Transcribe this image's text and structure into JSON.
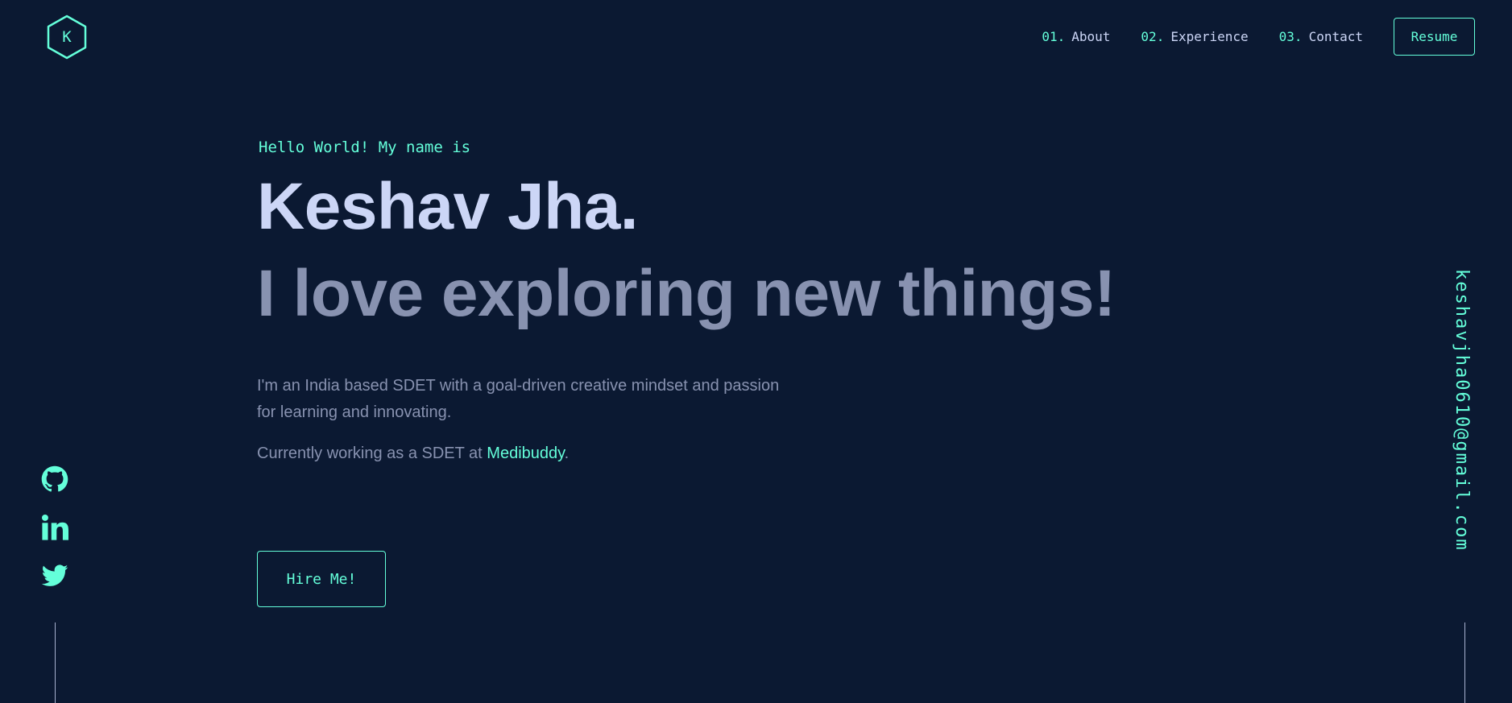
{
  "logo": {
    "letter": "K"
  },
  "nav": {
    "items": [
      {
        "number": "01.",
        "label": "About"
      },
      {
        "number": "02.",
        "label": "Experience"
      },
      {
        "number": "03.",
        "label": "Contact"
      }
    ],
    "resume_label": "Resume"
  },
  "hero": {
    "greeting": "Hello World! My name is",
    "name": "Keshav Jha.",
    "tagline": "I love exploring new things!",
    "intro": "I'm an India based SDET with a goal-driven creative mindset and passion for learning and innovating.",
    "current_prefix": "Currently working as a SDET at ",
    "company": "Medibuddy",
    "current_suffix": ".",
    "cta_label": "Hire Me!"
  },
  "social": {
    "icons": [
      "github-icon",
      "linkedin-icon",
      "twitter-icon"
    ]
  },
  "email": "keshavjha0610@gmail.com",
  "colors": {
    "background": "#0b1932",
    "accent": "#64ffda",
    "heading": "#ccd6f6",
    "text": "#8892b0"
  }
}
